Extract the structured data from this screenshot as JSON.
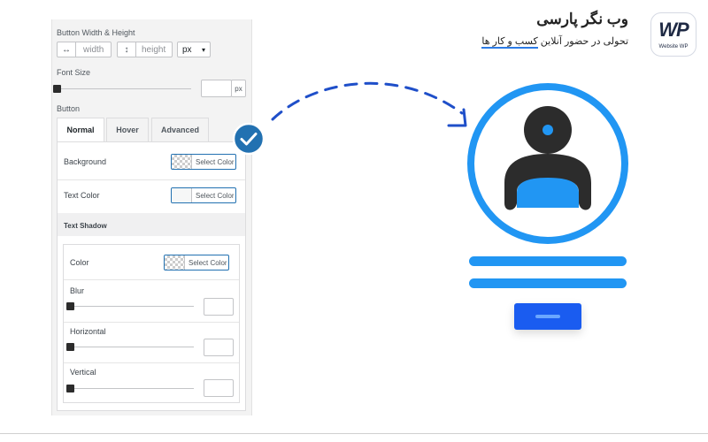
{
  "panel": {
    "button_size_label": "Button Width & Height",
    "width_placeholder": "width",
    "height_placeholder": "height",
    "unit_select": "px",
    "font_size_label": "Font Size",
    "font_size_unit": "px",
    "button_section_label": "Button",
    "tabs": [
      {
        "label": "Normal",
        "active": true
      },
      {
        "label": "Hover",
        "active": false
      },
      {
        "label": "Advanced",
        "active": false
      }
    ],
    "background_label": "Background",
    "text_color_label": "Text Color",
    "select_color": "Select Color",
    "text_shadow_label": "Text Shadow",
    "shadow": {
      "color_label": "Color",
      "blur_label": "Blur",
      "horizontal_label": "Horizontal",
      "vertical_label": "Vertical"
    }
  },
  "brand": {
    "title": "وب نگر پارسی",
    "subtitle_prefix": "تحولی در حضور آنلاین ",
    "subtitle_highlight": "کسب و کار ها",
    "logo_text": "WP",
    "logo_caption": "Website WP"
  },
  "colors": {
    "accent": "#2196f3",
    "check_badge": "#2271b1",
    "dark": "#2c2c2c",
    "button_blue": "#1a5cf0"
  }
}
